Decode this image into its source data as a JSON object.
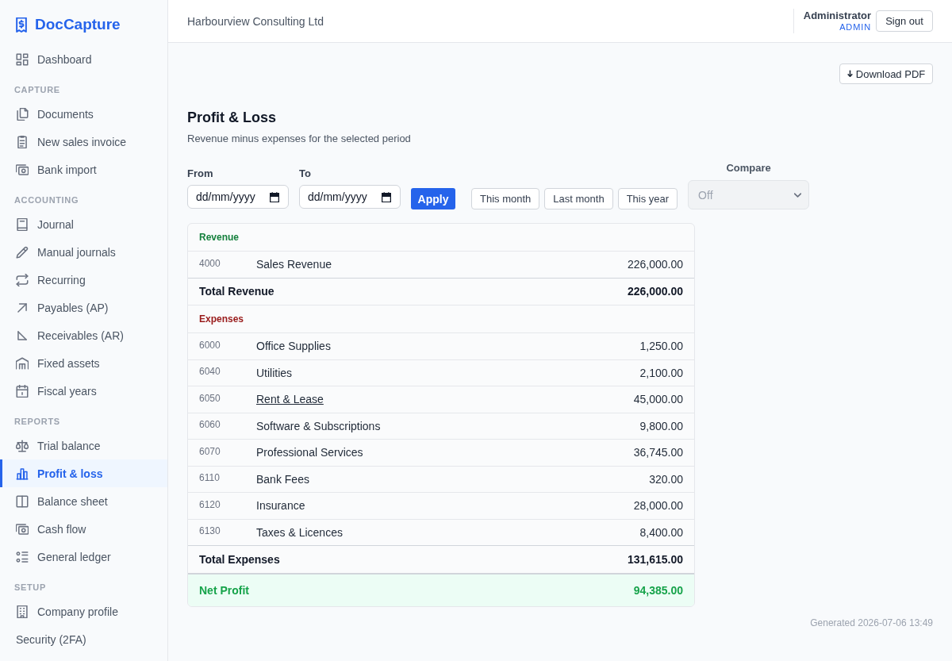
{
  "sidebar": {
    "brand": "DocCapture",
    "groups": [
      {
        "items": [
          {
            "label": "Dashboard",
            "selected": false
          }
        ]
      },
      {
        "heading": "CAPTURE",
        "items": [
          {
            "label": "Documents",
            "selected": false
          },
          {
            "label": "New sales invoice",
            "selected": false
          },
          {
            "label": "Bank import",
            "selected": false
          }
        ]
      },
      {
        "heading": "ACCOUNTING",
        "items": [
          {
            "label": "Journal",
            "selected": false
          },
          {
            "label": "Manual journals",
            "selected": false
          },
          {
            "label": "Recurring",
            "selected": false
          },
          {
            "label": "Payables (AP)",
            "selected": false
          },
          {
            "label": "Receivables (AR)",
            "selected": false
          },
          {
            "label": "Fixed assets",
            "selected": false
          },
          {
            "label": "Fiscal years",
            "selected": false
          }
        ]
      },
      {
        "heading": "REPORTS",
        "items": [
          {
            "label": "Trial balance",
            "selected": false
          },
          {
            "label": "Profit & loss",
            "selected": true
          },
          {
            "label": "Balance sheet",
            "selected": false
          },
          {
            "label": "Cash flow",
            "selected": false
          },
          {
            "label": "General ledger",
            "selected": false
          }
        ]
      },
      {
        "heading": "SETUP",
        "items": [
          {
            "label": "Company profile",
            "selected": false
          },
          {
            "label": "Security (2FA)",
            "selected": false
          }
        ]
      }
    ]
  },
  "header": {
    "company": "Harbourview Consulting Ltd",
    "user": {
      "name": "Administrator",
      "role": "ADMIN"
    },
    "sign_out_button": "Sign out"
  },
  "download_button": "Download PDF",
  "report": {
    "title": "Profit & Loss",
    "subtitle": "Revenue minus expenses for the selected period",
    "filters": {
      "from": {
        "label": "From",
        "placeholder": "dd/mm/yyyy"
      },
      "to": {
        "label": "To",
        "placeholder": "dd/mm/yyyy"
      },
      "apply_button": "Apply",
      "presets": [
        "This month",
        "Last month",
        "This year"
      ],
      "compare": {
        "label": "Compare",
        "value": "Off",
        "disabled": true
      }
    },
    "sections": [
      {
        "title": "Revenue",
        "color": "#15803d",
        "rows": [
          {
            "code": "4000",
            "name": "Sales Revenue",
            "amount": "226,000.00",
            "hovered": false
          }
        ],
        "total": {
          "label": "Total Revenue",
          "amount": "226,000.00"
        }
      },
      {
        "title": "Expenses",
        "color": "#991b1b",
        "rows": [
          {
            "code": "6000",
            "name": "Office Supplies",
            "amount": "1,250.00",
            "hovered": false
          },
          {
            "code": "6040",
            "name": "Utilities",
            "amount": "2,100.00",
            "hovered": false
          },
          {
            "code": "6050",
            "name": "Rent & Lease",
            "amount": "45,000.00",
            "hovered": true
          },
          {
            "code": "6060",
            "name": "Software & Subscriptions",
            "amount": "9,800.00",
            "hovered": false
          },
          {
            "code": "6070",
            "name": "Professional Services",
            "amount": "36,745.00",
            "hovered": false
          },
          {
            "code": "6110",
            "name": "Bank Fees",
            "amount": "320.00",
            "hovered": false
          },
          {
            "code": "6120",
            "name": "Insurance",
            "amount": "28,000.00",
            "hovered": false
          },
          {
            "code": "6130",
            "name": "Taxes & Licences",
            "amount": "8,400.00",
            "hovered": false
          }
        ],
        "total": {
          "label": "Total Expenses",
          "amount": "131,615.00"
        }
      }
    ],
    "net_profit": {
      "label": "Net Profit",
      "amount": "94,385.00"
    },
    "generated": "Generated 2026-07-06 13:49"
  }
}
